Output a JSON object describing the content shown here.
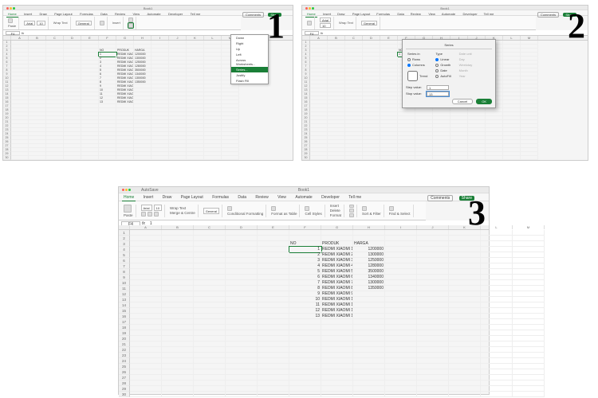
{
  "app": {
    "title": "Book1",
    "autosave": "AutoSave"
  },
  "tabs": [
    "Home",
    "Insert",
    "Draw",
    "Page Layout",
    "Formulas",
    "Data",
    "Review",
    "View",
    "Automate",
    "Developer",
    "Tell me"
  ],
  "rhs": {
    "comments": "Comments",
    "share": "Share"
  },
  "ribbon": {
    "paste": "Paste",
    "font": "Arial",
    "size": "10",
    "wrap": "Wrap Text",
    "merge": "Merge & Centre",
    "numfmt": "General",
    "cond": "Conditional Formatting",
    "fmttbl": "Format as Table",
    "styles": "Cell Styles",
    "insert": "Insert",
    "delete": "Delete",
    "format": "Format",
    "sort": "Sort & Filter",
    "find": "Find & Select"
  },
  "columns": [
    "A",
    "B",
    "C",
    "D",
    "E",
    "F",
    "G",
    "H",
    "I",
    "J",
    "K",
    "L",
    "M"
  ],
  "panel1": {
    "selected_cell": "F4",
    "data": {
      "header": {
        "F": "NO",
        "G": "PRODUK",
        "H": "HARGA"
      },
      "rows": [
        {
          "n": 1,
          "p": "REDMI XIAOMI 1",
          "h": "1200000"
        },
        {
          "n": 2,
          "p": "REDMI XIAOMI 2",
          "h": "1300000"
        },
        {
          "n": 3,
          "p": "REDMI XIAOMI 3",
          "h": "1250000"
        },
        {
          "n": 4,
          "p": "REDMI XIAOMI 4",
          "h": "1280000"
        },
        {
          "n": 5,
          "p": "REDMI XIAOMI 5",
          "h": "3500000"
        },
        {
          "n": 6,
          "p": "REDMI XIAOMI 6",
          "h": "1340000"
        },
        {
          "n": 7,
          "p": "REDMI XIAOMI 7",
          "h": "1300000"
        },
        {
          "n": 8,
          "p": "REDMI XIAOMI 8",
          "h": "1350000"
        },
        {
          "n": 9,
          "p": "REDMI XIAOMI 9"
        },
        {
          "n": 10,
          "p": "REDMI XIAOMI 10"
        },
        {
          "n": 11,
          "p": "REDMI XIAOMI 11"
        },
        {
          "n": 12,
          "p": "REDMI XIAOMI 12"
        },
        {
          "n": 13,
          "p": "REDMI XIAOMI 13"
        }
      ]
    },
    "fill_menu": {
      "items": [
        "Down",
        "Right",
        "Up",
        "Left",
        "Across Worksheets...",
        "Series...",
        "Justify",
        "Flash Fill"
      ],
      "highlight": "Series..."
    }
  },
  "panel2": {
    "dialog": {
      "title": "Series",
      "sections": {
        "series_in": {
          "label": "Series in",
          "opts": [
            "Rows",
            "Columns"
          ],
          "sel": "Columns"
        },
        "type": {
          "label": "Type",
          "opts": [
            "Linear",
            "Growth",
            "Date",
            "AutoFill"
          ],
          "sel": "Linear"
        },
        "date_unit": {
          "label": "Date unit",
          "opts": [
            "Day",
            "Weekday",
            "Month",
            "Year"
          ]
        }
      },
      "trend": "Trend",
      "step_label": "Step value:",
      "step": "1",
      "stop_label": "Stop value:",
      "stop": "13",
      "cancel": "Cancel",
      "ok": "OK"
    }
  },
  "panel3": {
    "selected_cell": "F4",
    "formula": "1",
    "header": {
      "F": "NO",
      "G": "PRODUK",
      "H": "HARGA"
    }
  }
}
